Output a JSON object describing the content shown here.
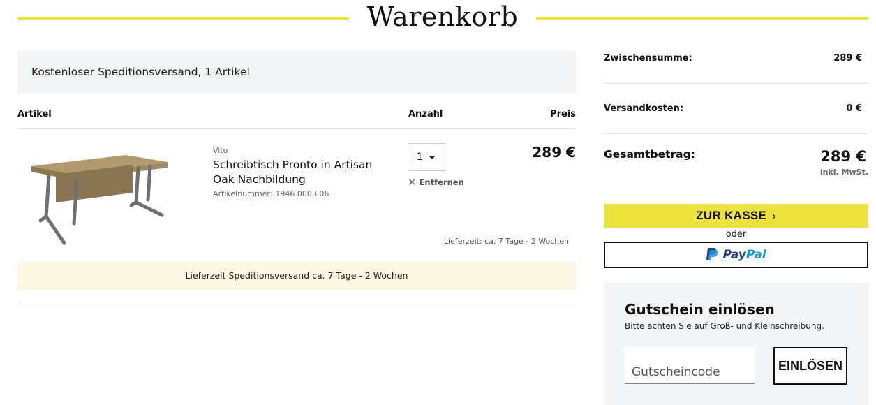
{
  "header": {
    "title": "Warenkorb"
  },
  "shipping_banner": {
    "text": "Kostenloser Speditionsversand, 1 Artikel"
  },
  "columns": {
    "article": "Artikel",
    "quantity": "Anzahl",
    "price": "Preis"
  },
  "item": {
    "brand": "Vito",
    "name": "Schreibtisch Pronto in Artisan Oak Nachbildung",
    "sku_label": "Artikelnummer:",
    "sku": "1946.0003.06",
    "quantity": "1",
    "remove_label": "Entfernen",
    "price": "289 €",
    "delivery": "Lieferzeit: ca. 7 Tage - 2 Wochen"
  },
  "delivery_banner": {
    "text": "Lieferzeit Speditionsversand ca. 7 Tage - 2 Wochen"
  },
  "summary": {
    "subtotal_label": "Zwischensumme:",
    "subtotal_value": "289 €",
    "shipping_label": "Versandkosten:",
    "shipping_value": "0 €",
    "total_label": "Gesamtbetrag:",
    "total_value": "289 €",
    "tax_note": "inkl. MwSt."
  },
  "checkout": {
    "label": "ZUR KASSE",
    "or_text": "oder",
    "paypal_pay": "Pay",
    "paypal_pal": "Pal"
  },
  "coupon": {
    "title": "Gutschein einlösen",
    "hint": "Bitte achten Sie auf Groß- und Kleinschreibung.",
    "placeholder": "Gutscheincode",
    "button": "EINLÖSEN"
  },
  "colors": {
    "accent": "#ece23c",
    "panel": "#f3f4f5",
    "delivery_banner": "#fbf7e2",
    "paypal_dark": "#253b80",
    "paypal_light": "#179bd7"
  }
}
